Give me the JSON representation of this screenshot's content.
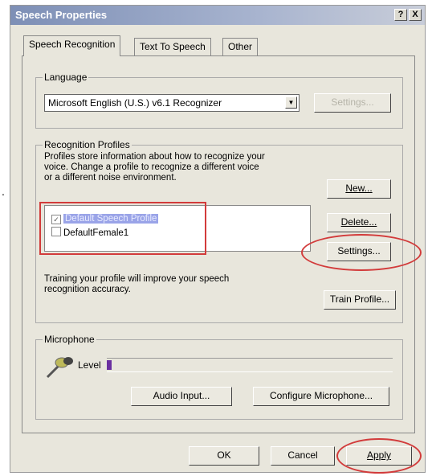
{
  "window": {
    "title": "Speech Properties",
    "help_btn": "?",
    "close_btn": "X"
  },
  "tabs": [
    {
      "label": "Speech Recognition",
      "active": true
    },
    {
      "label": "Text To Speech",
      "active": false
    },
    {
      "label": "Other",
      "active": false
    }
  ],
  "language": {
    "group_label": "Language",
    "selected": "Microsoft English (U.S.) v6.1 Recognizer",
    "settings_label": "Settings..."
  },
  "profiles": {
    "group_label": "Recognition Profiles",
    "description": [
      "Profiles store information about how to recognize your",
      "voice.  Change a profile to recognize a different voice",
      "or a different noise environment."
    ],
    "items": [
      {
        "label": "Default Speech Profile",
        "checked": true,
        "selected": true
      },
      {
        "label": "DefaultFemale1",
        "checked": false,
        "selected": false
      }
    ],
    "new_label": "New...",
    "delete_label": "Delete...",
    "settings_label": "Settings...",
    "training": [
      "Training your profile will improve your speech",
      "recognition accuracy."
    ],
    "train_label": "Train Profile..."
  },
  "microphone": {
    "group_label": "Microphone",
    "level_label": "Level",
    "audio_input_label": "Audio Input...",
    "configure_label": "Configure Microphone..."
  },
  "footer": {
    "ok_label": "OK",
    "cancel_label": "Cancel",
    "apply_label": "Apply"
  },
  "colors": {
    "annotation": "#d23b3b",
    "selection": "#9aa4e8",
    "level_meter": "#6a2fa0"
  }
}
